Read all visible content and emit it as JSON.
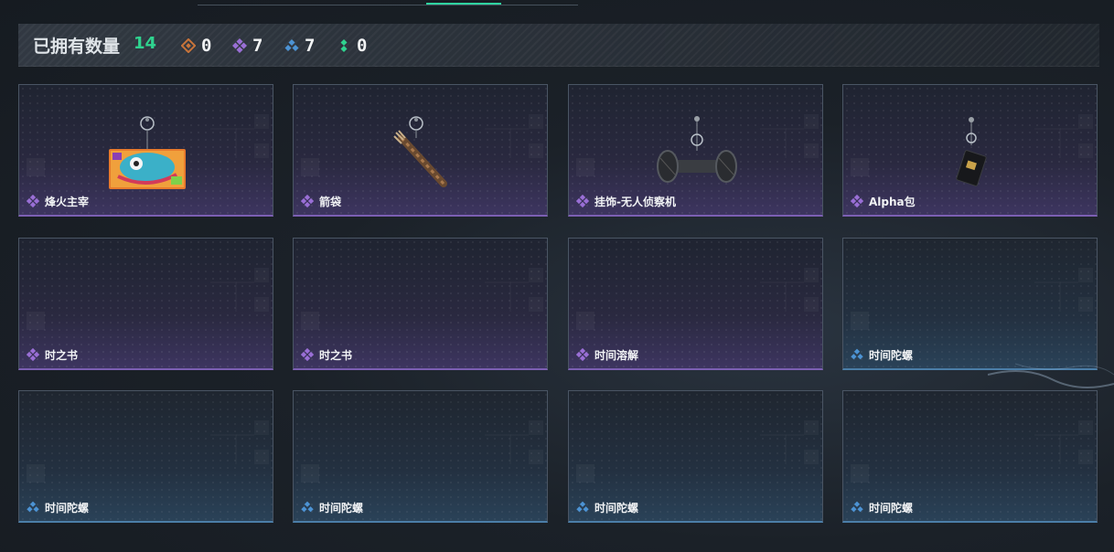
{
  "header": {
    "partial_title": "",
    "active_tab_color": "#2fd5a0"
  },
  "summary": {
    "owned_label": "已拥有数量",
    "owned_count": "14",
    "stats": [
      {
        "icon": "orange-diamond-icon",
        "color": "#c8743a",
        "value": "0"
      },
      {
        "icon": "purple-diamond-icon",
        "color": "#9a6fd6",
        "value": "7"
      },
      {
        "icon": "blue-diamond-icon",
        "color": "#4c93d4",
        "value": "7"
      },
      {
        "icon": "green-dots-icon",
        "color": "#2fd38f",
        "value": "0"
      }
    ]
  },
  "items": [
    {
      "name": "烽火主宰",
      "rarity": "purple",
      "art": "graffiti-tag-charm"
    },
    {
      "name": "箭袋",
      "rarity": "purple",
      "art": "quiver-charm"
    },
    {
      "name": "挂饰-无人侦察机",
      "rarity": "purple",
      "art": "drone-charm"
    },
    {
      "name": "Alpha包",
      "rarity": "purple",
      "art": "pouch-charm"
    },
    {
      "name": "时之书",
      "rarity": "purple",
      "art": ""
    },
    {
      "name": "时之书",
      "rarity": "purple",
      "art": ""
    },
    {
      "name": "时间溶解",
      "rarity": "purple",
      "art": ""
    },
    {
      "name": "时间陀螺",
      "rarity": "blue",
      "art": ""
    },
    {
      "name": "时间陀螺",
      "rarity": "blue",
      "art": ""
    },
    {
      "name": "时间陀螺",
      "rarity": "blue",
      "art": ""
    },
    {
      "name": "时间陀螺",
      "rarity": "blue",
      "art": ""
    },
    {
      "name": "时间陀螺",
      "rarity": "blue",
      "art": ""
    }
  ],
  "colors": {
    "purple_rarity": "#9a6fd6",
    "blue_rarity": "#4c93d4",
    "owned_count": "#2fd38f"
  }
}
